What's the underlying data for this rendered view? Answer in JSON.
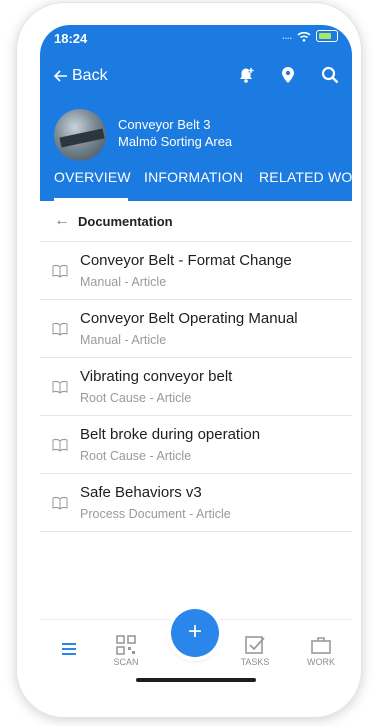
{
  "status_bar": {
    "time": "18:24",
    "signal": "....",
    "colors": {
      "battery_fill": "#a6e66a"
    }
  },
  "navbar": {
    "back_label": "Back",
    "icons": [
      "notification-add-icon",
      "location-pin-icon",
      "search-icon"
    ]
  },
  "asset": {
    "name": "Conveyor Belt 3",
    "area": "Malmö Sorting Area"
  },
  "tabs": [
    {
      "label": "OVERVIEW",
      "active": true
    },
    {
      "label": "INFORMATION",
      "active": false
    },
    {
      "label": "RELATED WO",
      "active": false
    }
  ],
  "section": {
    "title": "Documentation"
  },
  "documents": [
    {
      "title": "Conveyor Belt - Format Change",
      "subtitle": "Manual - Article"
    },
    {
      "title": "Conveyor Belt Operating Manual",
      "subtitle": "Manual - Article"
    },
    {
      "title": "Vibrating conveyor belt",
      "subtitle": "Root Cause - Article"
    },
    {
      "title": "Belt broke during operation",
      "subtitle": "Root Cause - Article"
    },
    {
      "title": "Safe Behaviors v3",
      "subtitle": "Process Document - Article"
    }
  ],
  "bottom_nav": {
    "scan_label": "SCAN",
    "tasks_label": "TASKS",
    "work_label": "WORK",
    "fab_label": "+"
  },
  "colors": {
    "primary": "#1c7be0",
    "fab": "#2a86ea",
    "text": "#1e1e1e",
    "muted": "#9a9a9a"
  }
}
